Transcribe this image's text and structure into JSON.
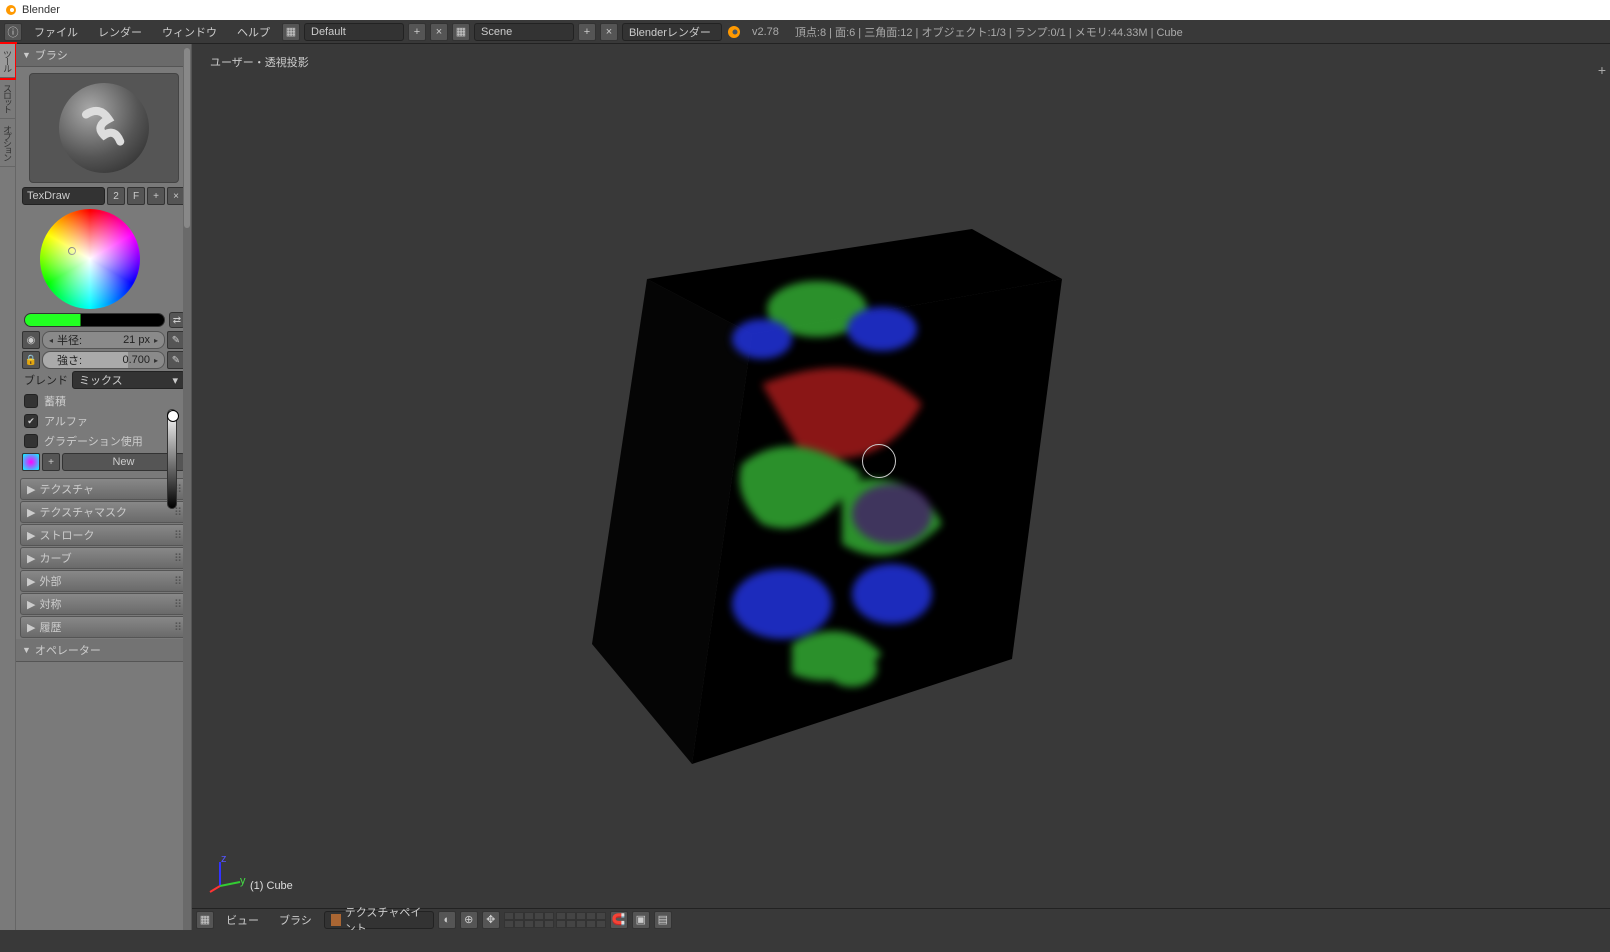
{
  "titlebar": {
    "app": "Blender"
  },
  "menu": {
    "file": "ファイル",
    "render": "レンダー",
    "window": "ウィンドウ",
    "help": "ヘルプ"
  },
  "top": {
    "layout": "Default",
    "scene": "Scene",
    "engine": "Blenderレンダー",
    "version": "v2.78",
    "stats": "頂点:8 | 面:6 | 三角面:12 | オブジェクト:1/3 | ランプ:0/1 | メモリ:44.33M | Cube"
  },
  "tabs": {
    "tool": "ツール",
    "t2": "スロット",
    "t3": "オプション"
  },
  "brush": {
    "title": "ブラシ",
    "name": "TexDraw",
    "users": "2",
    "fake": "F",
    "radius_lbl": "半径:",
    "radius_val": "21 px",
    "strength_lbl": "強さ:",
    "strength_val": "0.700",
    "blend_lbl": "ブレンド",
    "blend_val": "ミックス",
    "accum": "蓄積",
    "alpha": "アルファ",
    "grad": "グラデーション使用",
    "new": "New"
  },
  "panels": {
    "tex": "テクスチャ",
    "texmask": "テクスチャマスク",
    "stroke": "ストローク",
    "curve": "カーブ",
    "ext": "外部",
    "sym": "対称",
    "hist": "履歴"
  },
  "operator": "オペレーター",
  "viewport": {
    "projection": "ユーザー・透視投影",
    "obj": "(1) Cube",
    "axis_y": "y",
    "axis_z": "z"
  },
  "btm": {
    "view": "ビュー",
    "brush": "ブラシ",
    "mode": "テクスチャペイント"
  }
}
